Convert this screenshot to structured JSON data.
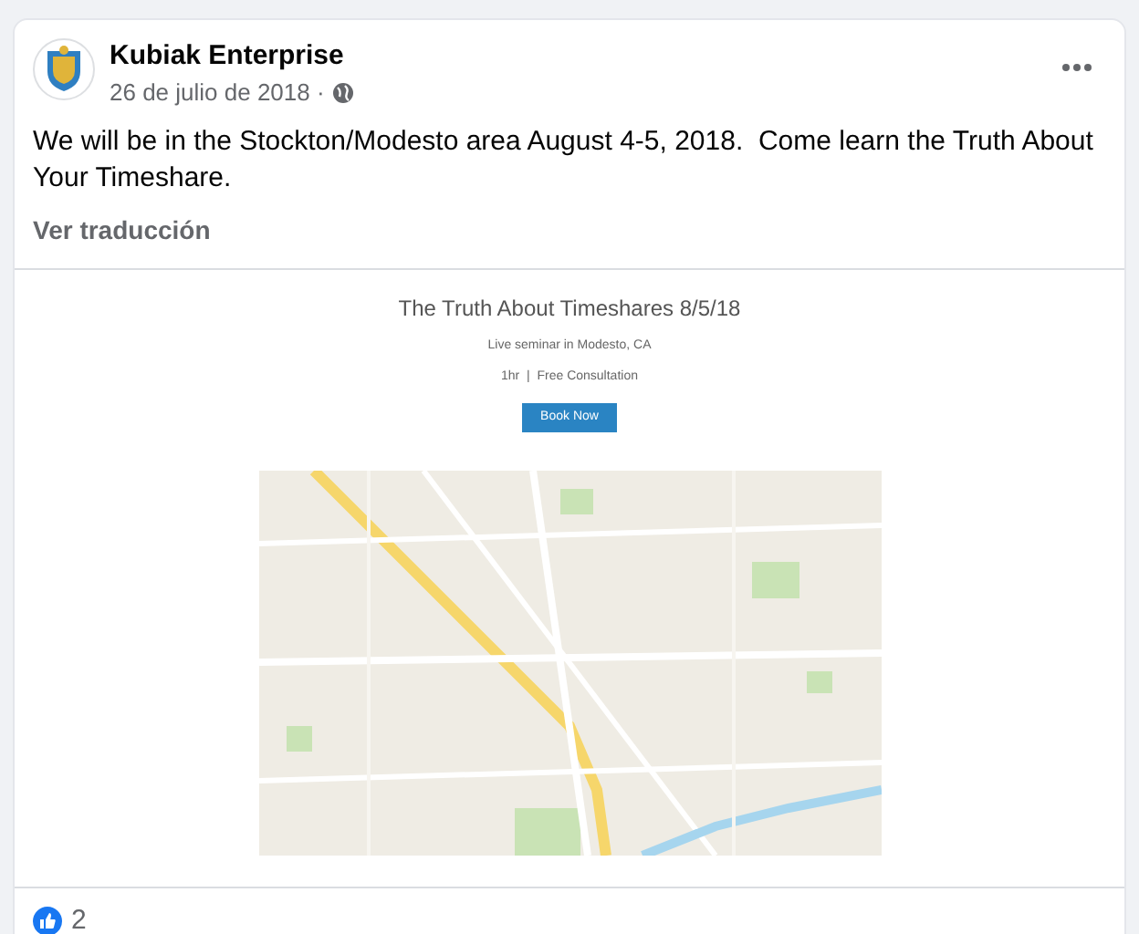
{
  "post": {
    "author": "Kubiak Enterprise",
    "date": "26 de julio de 2018 ·",
    "text": "We will be in the Stockton/Modesto area August 4-5, 2018.  Come learn the Truth About Your Timeshare.",
    "translate_link": "Ver traducción"
  },
  "attachment": {
    "title": "The Truth About Timeshares 8/5/18",
    "subtitle": "Live seminar in Modesto, CA",
    "details": "1hr  |  Free Consultation",
    "button": "Book Now",
    "kind": "picture"
  },
  "reactions": {
    "count": "2"
  }
}
